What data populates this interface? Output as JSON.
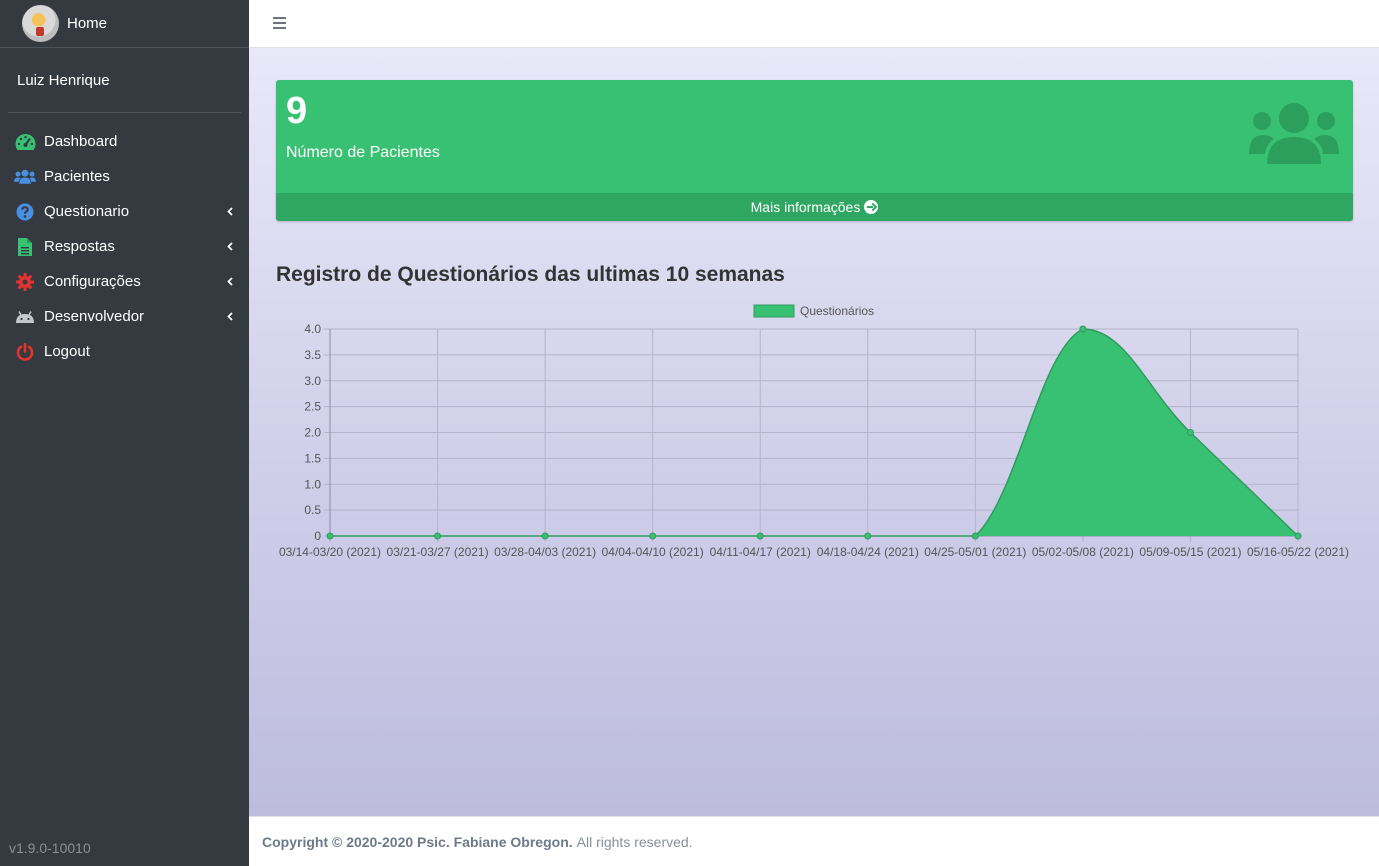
{
  "brand": {
    "title": "Home"
  },
  "user": {
    "name": "Luiz Henrique"
  },
  "sidebar": {
    "items": [
      {
        "label": "Dashboard",
        "icon": "tachometer-icon",
        "color": "#38c172"
      },
      {
        "label": "Pacientes",
        "icon": "users-icon",
        "color": "#4a90e2"
      },
      {
        "label": "Questionario",
        "icon": "question-circle-icon",
        "color": "#4a90e2"
      },
      {
        "label": "Respostas",
        "icon": "file-icon",
        "color": "#38c172"
      },
      {
        "label": "Configurações",
        "icon": "gear-icon",
        "color": "#e3342f"
      },
      {
        "label": "Desenvolvedor",
        "icon": "android-icon",
        "color": "#adb5bd"
      },
      {
        "label": "Logout",
        "icon": "power-icon",
        "color": "#e3342f"
      }
    ],
    "version": "v1.9.0-10010"
  },
  "stat_box": {
    "value": "9",
    "label": "Número de Pacientes",
    "footer_label": "Mais informações",
    "color": "#38c172"
  },
  "chart": {
    "heading": "Registro de Questionários das ultimas 10 semanas"
  },
  "chart_data": {
    "type": "area",
    "categories": [
      "03/14-03/20 (2021)",
      "03/21-03/27 (2021)",
      "03/28-04/03 (2021)",
      "04/04-04/10 (2021)",
      "04/11-04/17 (2021)",
      "04/18-04/24 (2021)",
      "04/25-05/01 (2021)",
      "05/02-05/08 (2021)",
      "05/09-05/15 (2021)",
      "05/16-05/22 (2021)"
    ],
    "series": [
      {
        "name": "Questionários",
        "values": [
          0,
          0,
          0,
          0,
          0,
          0,
          0,
          4,
          2,
          0
        ],
        "color": "#38c172"
      }
    ],
    "yticks": [
      "0",
      "0.5",
      "1.0",
      "1.5",
      "2.0",
      "2.5",
      "3.0",
      "3.5",
      "4.0"
    ],
    "ylim": [
      0,
      4
    ],
    "grid": true,
    "legend": "top"
  },
  "footer": {
    "copyright": "Copyright © 2020-2020 Psic. Fabiane Obregon.",
    "rights": "All rights reserved."
  }
}
